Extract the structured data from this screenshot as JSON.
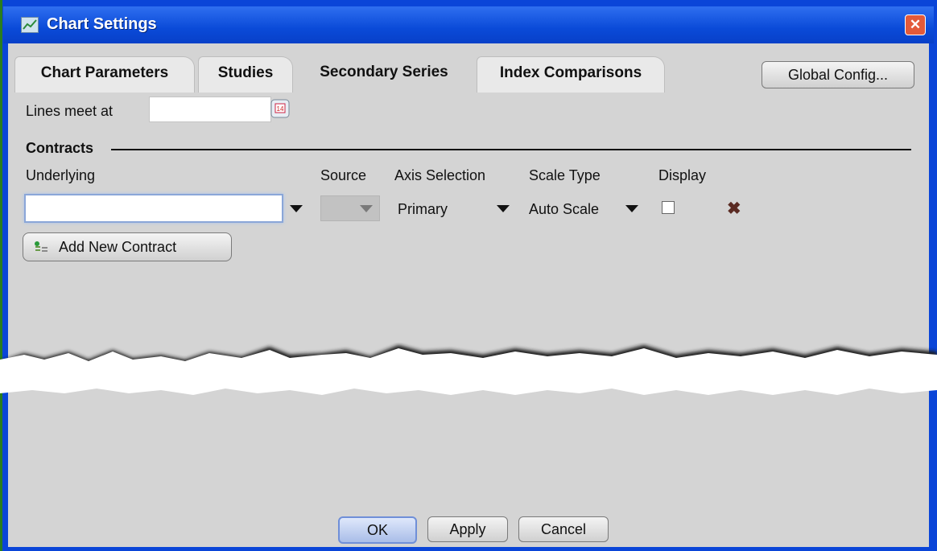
{
  "window": {
    "title": "Chart Settings",
    "title_icon": "chart-icon",
    "close_glyph": "✕",
    "colors": {
      "titlebar": "#0a4ad8",
      "panel": "#d4d4d4",
      "delete": "#5a2a22"
    }
  },
  "tabs": [
    {
      "label": "Chart Parameters"
    },
    {
      "label": "Studies"
    },
    {
      "label": "Secondary Series",
      "active": true
    },
    {
      "label": "Index Comparisons"
    }
  ],
  "global_config_label": "Global Config...",
  "lines_meet": {
    "label": "Lines meet at",
    "value": "",
    "icon": "calendar-icon"
  },
  "contracts": {
    "section_label": "Contracts",
    "headers": {
      "underlying": "Underlying",
      "source": "Source",
      "axis": "Axis Selection",
      "scale": "Scale Type",
      "display": "Display"
    },
    "row": {
      "underlying": "",
      "source": "",
      "axis": "Primary",
      "scale": "Auto Scale",
      "display_checked": false,
      "delete_glyph": "✖"
    },
    "add_label": "Add New Contract"
  },
  "footer": {
    "ok": "OK",
    "apply": "Apply",
    "cancel": "Cancel"
  }
}
